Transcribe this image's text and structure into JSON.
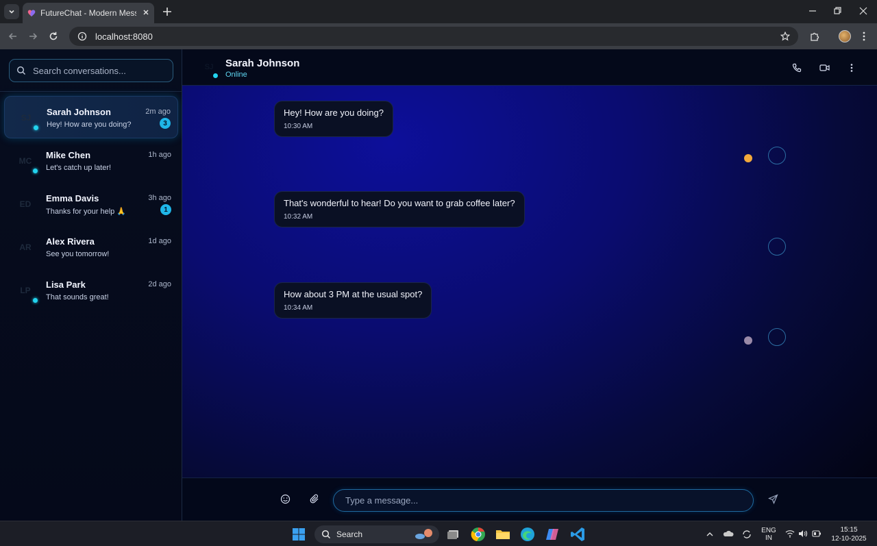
{
  "browser": {
    "tab_title": "FutureChat - Modern Messagin",
    "url": "localhost:8080"
  },
  "sidebar": {
    "search_placeholder": "Search conversations...",
    "conversations": [
      {
        "initials": "SJ",
        "name": "Sarah Johnson",
        "time": "2m ago",
        "preview": "Hey! How are you doing?",
        "badge": "3",
        "online": true,
        "active": true
      },
      {
        "initials": "MC",
        "name": "Mike Chen",
        "time": "1h ago",
        "preview": "Let's catch up later!",
        "badge": "",
        "online": true,
        "active": false
      },
      {
        "initials": "ED",
        "name": "Emma Davis",
        "time": "3h ago",
        "preview": "Thanks for your help 🙏",
        "badge": "1",
        "online": false,
        "active": false
      },
      {
        "initials": "AR",
        "name": "Alex Rivera",
        "time": "1d ago",
        "preview": "See you tomorrow!",
        "badge": "",
        "online": false,
        "active": false
      },
      {
        "initials": "LP",
        "name": "Lisa Park",
        "time": "2d ago",
        "preview": "That sounds great!",
        "badge": "",
        "online": true,
        "active": false
      }
    ]
  },
  "chat": {
    "contact_initials": "SJ",
    "contact_name": "Sarah Johnson",
    "contact_status": "Online",
    "messages": [
      {
        "text": "Hey! How are you doing?",
        "time": "10:30 AM"
      },
      {
        "text": "That's wonderful to hear! Do you want to grab coffee later?",
        "time": "10:32 AM"
      },
      {
        "text": "How about 3 PM at the usual spot?",
        "time": "10:34 AM"
      }
    ],
    "composer_placeholder": "Type a message..."
  },
  "taskbar": {
    "search_label": "Search",
    "lang_line1": "ENG",
    "lang_line2": "IN",
    "clock_time": "15:15",
    "clock_date": "12-10-2025"
  },
  "colors": {
    "accent": "#22d3ee",
    "badge": "#1fb6e8",
    "chat_bg": "#0a0c70"
  }
}
